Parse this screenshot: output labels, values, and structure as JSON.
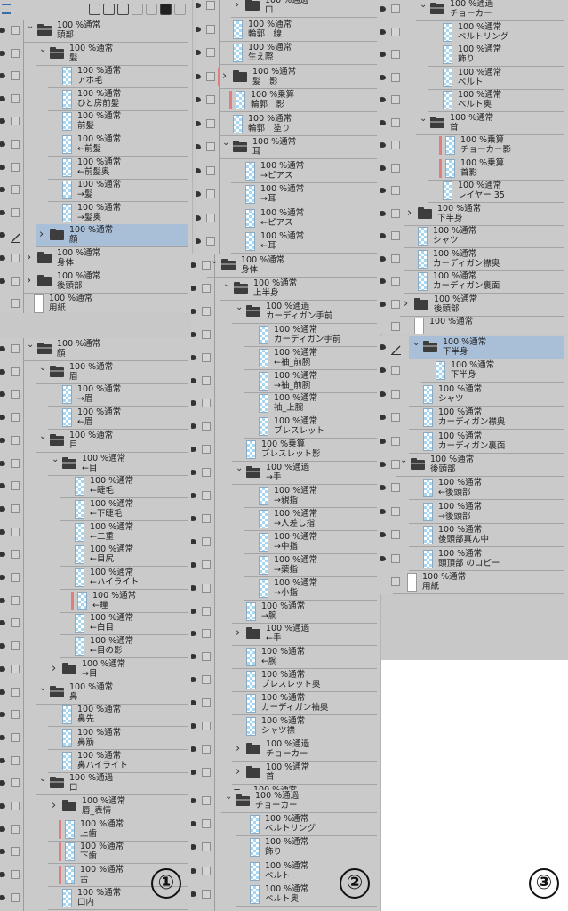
{
  "colors": {
    "selected": "#a9bfd7",
    "clip": "#e07d7d",
    "panel": "#cacaca"
  },
  "panels": [
    {
      "id": "col1-top",
      "rows": [
        {
          "m": "100 %通常",
          "n": "頭部",
          "t": "fo",
          "d": 0
        },
        {
          "m": "100 %通常",
          "n": "髪",
          "t": "fo",
          "d": 1
        },
        {
          "m": "100 %通常",
          "n": "アホ毛",
          "t": "l",
          "d": 2
        },
        {
          "m": "100 %通常",
          "n": "ひと房前髪",
          "t": "l",
          "d": 2
        },
        {
          "m": "100 %通常",
          "n": "前髪",
          "t": "l",
          "d": 2
        },
        {
          "m": "100 %通常",
          "n": "←前髪",
          "t": "l",
          "d": 2
        },
        {
          "m": "100 %通常",
          "n": "←前髪奥",
          "t": "l",
          "d": 2
        },
        {
          "m": "100 %通常",
          "n": "→髪",
          "t": "l",
          "d": 2
        },
        {
          "m": "100 %通常",
          "n": "→髪奥",
          "t": "l",
          "d": 2
        },
        {
          "m": "100 %通常",
          "n": "顔",
          "t": "fc",
          "d": 1,
          "s": true
        },
        {
          "m": "100 %通常",
          "n": "身体",
          "t": "fc",
          "d": 0
        },
        {
          "m": "100 %通常",
          "n": "後頭部",
          "t": "fc",
          "d": 0
        },
        {
          "m": "100 %通常",
          "n": "用紙",
          "t": "p",
          "d": -1
        }
      ]
    },
    {
      "id": "col1-bottom",
      "rows": [
        {
          "m": "100 %通常",
          "n": "顔",
          "t": "fo",
          "d": 0
        },
        {
          "m": "100 %通常",
          "n": "眉",
          "t": "fo",
          "d": 1
        },
        {
          "m": "100 %通常",
          "n": "→眉",
          "t": "l",
          "d": 2
        },
        {
          "m": "100 %通常",
          "n": "←眉",
          "t": "l",
          "d": 2
        },
        {
          "m": "100 %通常",
          "n": "目",
          "t": "fo",
          "d": 1
        },
        {
          "m": "100 %通常",
          "n": "←目",
          "t": "fo",
          "d": 2
        },
        {
          "m": "100 %通常",
          "n": "←睫毛",
          "t": "l",
          "d": 3
        },
        {
          "m": "100 %通常",
          "n": "←下睫毛",
          "t": "l",
          "d": 3
        },
        {
          "m": "100 %通常",
          "n": "←二重",
          "t": "l",
          "d": 3
        },
        {
          "m": "100 %通常",
          "n": "←目尻",
          "t": "l",
          "d": 3
        },
        {
          "m": "100 %通常",
          "n": "←ハイライト",
          "t": "l",
          "d": 3
        },
        {
          "m": "100 %通常",
          "n": "←瞳",
          "t": "l",
          "d": 3,
          "c": true
        },
        {
          "m": "100 %通常",
          "n": "←白目",
          "t": "l",
          "d": 3
        },
        {
          "m": "100 %通常",
          "n": "←目の影",
          "t": "l",
          "d": 3
        },
        {
          "m": "100 %通常",
          "n": "→目",
          "t": "fc",
          "d": 2
        },
        {
          "m": "100 %通常",
          "n": "鼻",
          "t": "fo",
          "d": 1
        },
        {
          "m": "100 %通常",
          "n": "鼻先",
          "t": "l",
          "d": 2
        },
        {
          "m": "100 %通常",
          "n": "鼻筋",
          "t": "l",
          "d": 2
        },
        {
          "m": "100 %通常",
          "n": "鼻ハイライト",
          "t": "l",
          "d": 2
        },
        {
          "m": "100 %通過",
          "n": "口",
          "t": "fo",
          "d": 1
        },
        {
          "m": "100 %通常",
          "n": "唇_表情",
          "t": "fc",
          "d": 2
        },
        {
          "m": "100 %通常",
          "n": "上歯",
          "t": "l",
          "d": 2,
          "c": true
        },
        {
          "m": "100 %通常",
          "n": "下歯",
          "t": "l",
          "d": 2,
          "c": true
        },
        {
          "m": "100 %通常",
          "n": "舌",
          "t": "l",
          "d": 2,
          "c": true
        },
        {
          "m": "100 %通常",
          "n": "口内",
          "t": "l",
          "d": 2
        }
      ]
    },
    {
      "id": "col2-top",
      "rows": [
        {
          "m": "100 %通過",
          "n": "口",
          "t": "fc",
          "d": 1
        },
        {
          "m": "100 %通常",
          "n": "輪郭　線",
          "t": "l",
          "d": 0
        },
        {
          "m": "100 %通常",
          "n": "生え際",
          "t": "l",
          "d": 0
        },
        {
          "m": "100 %通常",
          "n": "髪　影",
          "t": "fc",
          "d": 0,
          "c": true
        },
        {
          "m": "100 %乗算",
          "n": "輪郭　影",
          "t": "l",
          "d": 0,
          "c": true
        },
        {
          "m": "100 %通常",
          "n": "輪郭　塗り",
          "t": "l",
          "d": 0
        },
        {
          "m": "100 %通常",
          "n": "耳",
          "t": "fo",
          "d": 0
        },
        {
          "m": "100 %通常",
          "n": "→ピアス",
          "t": "l",
          "d": 1
        },
        {
          "m": "100 %通常",
          "n": "→耳",
          "t": "l",
          "d": 1
        },
        {
          "m": "100 %通常",
          "n": "←ピアス",
          "t": "l",
          "d": 1
        },
        {
          "m": "100 %通常",
          "n": "←耳",
          "t": "l",
          "d": 1
        }
      ]
    },
    {
      "id": "col2-middle",
      "rows": [
        {
          "m": "100 %通常",
          "n": "身体",
          "t": "fo",
          "d": 0
        },
        {
          "m": "100 %通常",
          "n": "上半身",
          "t": "fo",
          "d": 1
        },
        {
          "m": "100 %通過",
          "n": "カーディガン手前",
          "t": "fo",
          "d": 2
        },
        {
          "m": "100 %通常",
          "n": "カーディガン手前",
          "t": "l",
          "d": 3
        },
        {
          "m": "100 %通常",
          "n": "←袖_前腕",
          "t": "l",
          "d": 3
        },
        {
          "m": "100 %通常",
          "n": "→袖_前腕",
          "t": "l",
          "d": 3
        },
        {
          "m": "100 %通常",
          "n": "袖_上腕",
          "t": "l",
          "d": 3
        },
        {
          "m": "100 %通常",
          "n": "ブレスレット",
          "t": "l",
          "d": 3
        },
        {
          "m": "100 %乗算",
          "n": "ブレスレット影",
          "t": "l",
          "d": 2
        },
        {
          "m": "100 %通過",
          "n": "→手",
          "t": "fo",
          "d": 2
        },
        {
          "m": "100 %通常",
          "n": "→親指",
          "t": "l",
          "d": 3
        },
        {
          "m": "100 %通常",
          "n": "→人差し指",
          "t": "l",
          "d": 3
        },
        {
          "m": "100 %通常",
          "n": "→中指",
          "t": "l",
          "d": 3
        },
        {
          "m": "100 %通常",
          "n": "→薬指",
          "t": "l",
          "d": 3
        },
        {
          "m": "100 %通常",
          "n": "→小指",
          "t": "l",
          "d": 3
        },
        {
          "m": "100 %通常",
          "n": "→腕",
          "t": "l",
          "d": 2
        },
        {
          "m": "100 %通過",
          "n": "←手",
          "t": "fc",
          "d": 2
        },
        {
          "m": "100 %通常",
          "n": "←腕",
          "t": "l",
          "d": 2
        },
        {
          "m": "100 %通常",
          "n": "ブレスレット奥",
          "t": "l",
          "d": 2
        },
        {
          "m": "100 %通常",
          "n": "カーディガン袖奥",
          "t": "l",
          "d": 2
        },
        {
          "m": "100 %通常",
          "n": "シャツ襟",
          "t": "l",
          "d": 2
        },
        {
          "m": "100 %通過",
          "n": "チョーカー",
          "t": "fc",
          "d": 2
        },
        {
          "m": "100 %通常",
          "n": "首",
          "t": "fc",
          "d": 2
        },
        {
          "m": "100 %通常",
          "n": "",
          "t": "fo",
          "d": 1
        }
      ]
    },
    {
      "id": "col2-bottom",
      "rows": [
        {
          "m": "100 %通過",
          "n": "チョーカー",
          "t": "fo",
          "d": 0
        },
        {
          "m": "100 %通常",
          "n": "ベルトリング",
          "t": "l",
          "d": 1
        },
        {
          "m": "100 %通常",
          "n": "飾り",
          "t": "l",
          "d": 1
        },
        {
          "m": "100 %通常",
          "n": "ベルト",
          "t": "l",
          "d": 1
        },
        {
          "m": "100 %通常",
          "n": "ベルト奥",
          "t": "l",
          "d": 1
        }
      ]
    },
    {
      "id": "col3-top",
      "rows": [
        {
          "m": "100 %通過",
          "n": "チョーカー",
          "t": "fo",
          "d": 1
        },
        {
          "m": "100 %通常",
          "n": "ベルトリング",
          "t": "l",
          "d": 2
        },
        {
          "m": "100 %通常",
          "n": "飾り",
          "t": "l",
          "d": 2
        },
        {
          "m": "100 %通常",
          "n": "ベルト",
          "t": "l",
          "d": 2
        },
        {
          "m": "100 %通常",
          "n": "ベルト奥",
          "t": "l",
          "d": 2
        },
        {
          "m": "100 %通常",
          "n": "首",
          "t": "fo",
          "d": 1
        },
        {
          "m": "100 %乗算",
          "n": "チョーカー影",
          "t": "l",
          "d": 2,
          "c": true
        },
        {
          "m": "100 %乗算",
          "n": "首影",
          "t": "l",
          "d": 2,
          "c": true
        },
        {
          "m": "100 %通常",
          "n": "レイヤー 35",
          "t": "l",
          "d": 2
        },
        {
          "m": "100 %通常",
          "n": "下半身",
          "t": "fc",
          "d": 0
        },
        {
          "m": "100 %通常",
          "n": "シャツ",
          "t": "l",
          "d": 0
        },
        {
          "m": "100 %通常",
          "n": "カーディガン襟奥",
          "t": "l",
          "d": 0
        },
        {
          "m": "100 %通常",
          "n": "カーディガン裏面",
          "t": "l",
          "d": 0
        },
        {
          "m": "100 %通常",
          "n": "後頭部",
          "t": "fc",
          "d": -1
        },
        {
          "m": "100 %通常",
          "n": "",
          "t": "p",
          "d": -1
        }
      ]
    },
    {
      "id": "col3-bottom",
      "rows": [
        {
          "m": "100 %通常",
          "n": "下半身",
          "t": "fo",
          "d": 1,
          "s": true
        },
        {
          "m": "100 %通常",
          "n": "下半身",
          "t": "l",
          "d": 2
        },
        {
          "m": "100 %通常",
          "n": "シャツ",
          "t": "l",
          "d": 1
        },
        {
          "m": "100 %通常",
          "n": "カーディガン襟奥",
          "t": "l",
          "d": 1
        },
        {
          "m": "100 %通常",
          "n": "カーディガン裏面",
          "t": "l",
          "d": 1
        },
        {
          "m": "100 %通常",
          "n": "後頭部",
          "t": "fo",
          "d": 0
        },
        {
          "m": "100 %通常",
          "n": "←後頭部",
          "t": "l",
          "d": 1
        },
        {
          "m": "100 %通常",
          "n": "→後頭部",
          "t": "l",
          "d": 1
        },
        {
          "m": "100 %通常",
          "n": "後頭部真ん中",
          "t": "l",
          "d": 1
        },
        {
          "m": "100 %通常",
          "n": "頭頂部 のコピー",
          "t": "l",
          "d": 1
        },
        {
          "m": "100 %通常",
          "n": "用紙",
          "t": "p",
          "d": -1
        }
      ]
    }
  ],
  "labels": {
    "one": "①",
    "two": "②",
    "three": "③"
  }
}
